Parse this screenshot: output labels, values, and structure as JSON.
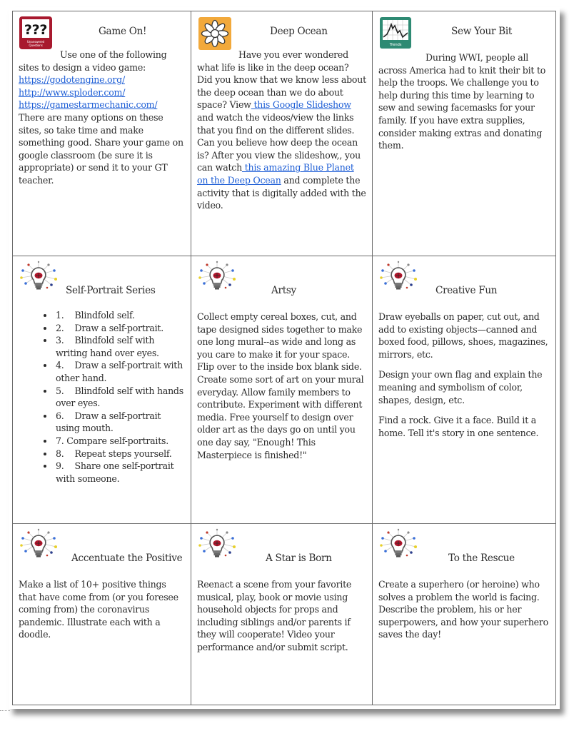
{
  "cards": [
    {
      "id": "game-on",
      "icon": "unanswered-questions-icon",
      "icon_label": "Unanswered Questions",
      "icon_glyph": "???",
      "title": "Game On!",
      "intro": "Use one of the following sites to design a video game:",
      "links": [
        "https://godotengine.org/",
        "http://www.sploder.com/",
        "https://gamestarmechanic.com/"
      ],
      "outro": "There are many options on these sites, so take time and make something good. Share your game on google classroom (be sure it is appropriate) or send it to your GT teacher."
    },
    {
      "id": "deep-ocean",
      "icon": "flower-icon",
      "title": "Deep Ocean",
      "text1": "Have you ever wondered what life is like in the deep ocean? Did you know that we know less about the deep ocean than we do about space? View",
      "link1": " this Google Slideshow",
      "text2": " and watch the videos/view the links that you find on the different slides. Can you believe how deep the ocean is? After you view the slideshow,, you can watch",
      "link2": " this amazing Blue Planet on the Deep Ocean",
      "text3": " and complete the activity that is digitally added with the video."
    },
    {
      "id": "sew-your-bit",
      "icon": "trends-chart-icon",
      "icon_label": "Trends",
      "title": "Sew Your Bit",
      "text": "During WWI, people all across America had to knit their bit to help the troops. We challenge you to help during this time by learning to sew and sewing facemasks for your family. If you have extra supplies, consider making extras and donating them."
    },
    {
      "id": "self-portrait-series",
      "icon": "lightbulb-brain-icon",
      "title": "Self-Portrait Series",
      "steps": [
        {
          "num": "1.",
          "text": "Blindfold self."
        },
        {
          "num": "2.",
          "text": "Draw a self-portrait."
        },
        {
          "num": "3.",
          "text": "Blindfold self with writing hand over eyes."
        },
        {
          "num": "4.",
          "text": "Draw a self-portrait with other hand."
        },
        {
          "num": "5.",
          "text": "Blindfold self with hands over eyes."
        },
        {
          "num": "6.",
          "text": "Draw a  self-portrait using mouth."
        },
        {
          "num": "7.",
          "text": "Compare self-portraits."
        },
        {
          "num": "8.",
          "text": "Repeat steps yourself."
        },
        {
          "num": "9.",
          "text": "Share one self-portrait with someone."
        }
      ]
    },
    {
      "id": "artsy",
      "icon": "lightbulb-brain-icon",
      "title": "Artsy",
      "text": "Collect empty cereal boxes, cut, and tape designed sides together to make one long mural--as wide and  long as you care to make it for your space. Flip over to the inside box blank side. Create some sort of art on your mural everyday. Allow family members to contribute. Experiment with different media. Free yourself to design over older art as the days go on until you one day say, \"Enough! This Masterpiece is finished!\""
    },
    {
      "id": "creative-fun",
      "icon": "lightbulb-brain-icon",
      "title": "Creative Fun",
      "paragraphs": [
        "Draw eyeballs on paper, cut out, and add to existing objects—canned and boxed food, pillows, shoes, magazines, mirrors, etc.",
        "Design your own flag and explain the meaning and symbolism of color, shapes, design, etc.",
        "Find a rock. Give it a face. Build it a home. Tell it's story in one sentence."
      ]
    },
    {
      "id": "accentuate-the-positive",
      "icon": "lightbulb-brain-icon",
      "title": "Accentuate the Positive",
      "text": "Make a list of 10+ positive things that have come from  (or you foresee coming from) the coronavirus pandemic.  Illustrate each with a doodle."
    },
    {
      "id": "a-star-is-born",
      "icon": "lightbulb-brain-icon",
      "title": "A Star is Born",
      "text": "Reenact a scene from your favorite musical, play, book or movie using household objects for props and including  siblings and/or parents if  they will cooperate! Video your performance and/or submit script."
    },
    {
      "id": "to-the-rescue",
      "icon": "lightbulb-brain-icon",
      "title": "To the Rescue",
      "text": "Create a superhero (or heroine) who solves  a problem the world is facing.  Describe the problem, his or her superpowers, and how your superhero saves the day!"
    }
  ],
  "colors": {
    "link": "#1f5fd6",
    "unanswered_icon_bg": "#a8192e",
    "flower_icon_bg": "#f2a93b",
    "trends_icon_bg": "#2e8a73",
    "border": "#6b6b6b"
  }
}
